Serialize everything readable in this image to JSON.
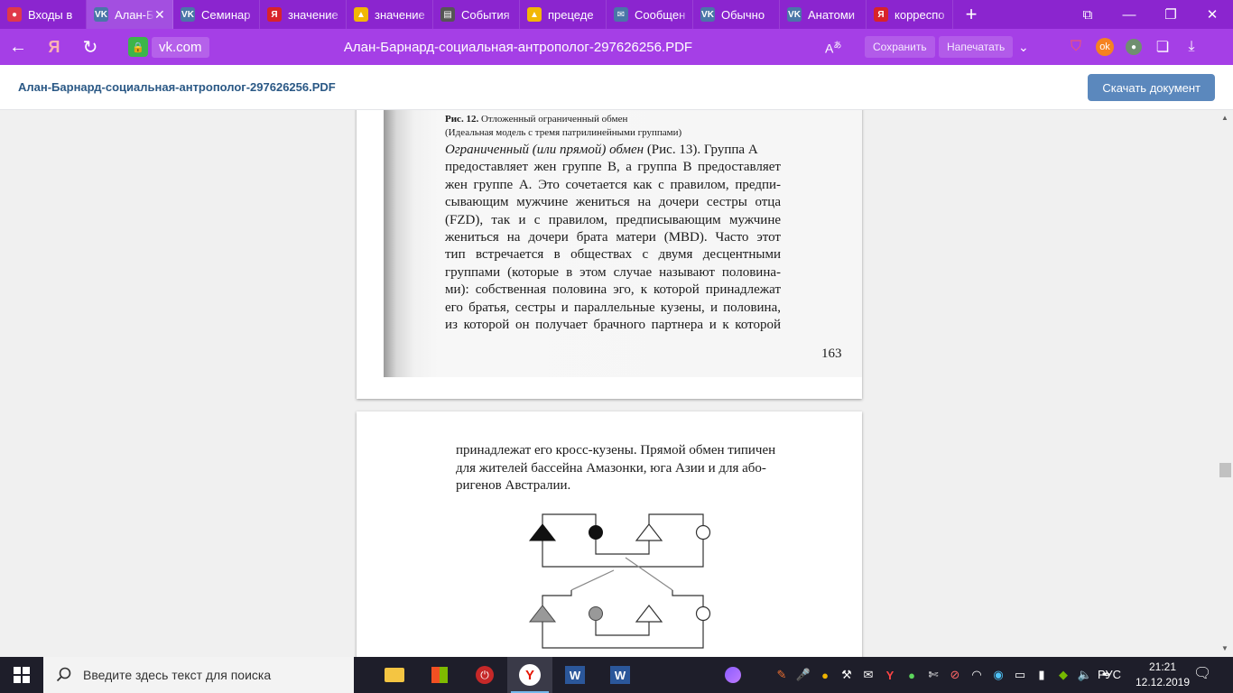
{
  "tabs": [
    {
      "title": "Входы в",
      "fav_color": "#e0394a",
      "fav_glyph": "●",
      "active": false
    },
    {
      "title": "Алан-Б",
      "fav_color": "#4a76a8",
      "fav_glyph": "VK",
      "active": true
    },
    {
      "title": "Семинар",
      "fav_color": "#4a76a8",
      "fav_glyph": "VK",
      "active": false
    },
    {
      "title": "значение",
      "fav_color": "#d8232a",
      "fav_glyph": "Я",
      "active": false
    },
    {
      "title": "значение",
      "fav_color": "#f2b705",
      "fav_glyph": "▲",
      "active": false
    },
    {
      "title": "События",
      "fav_color": "#555555",
      "fav_glyph": "▤",
      "active": false
    },
    {
      "title": "прецеде",
      "fav_color": "#f2b705",
      "fav_glyph": "▲",
      "active": false
    },
    {
      "title": "Сообщен",
      "fav_color": "#4a76a8",
      "fav_glyph": "✉",
      "active": false
    },
    {
      "title": "Обычно",
      "fav_color": "#4a76a8",
      "fav_glyph": "VK",
      "active": false
    },
    {
      "title": "Анатоми",
      "fav_color": "#4a76a8",
      "fav_glyph": "VK",
      "active": false
    },
    {
      "title": "корреспо",
      "fav_color": "#d8232a",
      "fav_glyph": "Я",
      "active": false
    }
  ],
  "address": {
    "domain": "vk.com",
    "page_title": "Алан-Барнард-социальная-антрополог-297626256.PDF",
    "save_label": "Сохранить",
    "print_label": "Напечатать"
  },
  "doc_header": {
    "filename": "Алан-Барнард-социальная-антрополог-297626256.PDF",
    "download_label": "Скачать документ"
  },
  "page1": {
    "caption_bold": "Рис. 12.",
    "caption_rest": " Отложенный ограниченный обмен",
    "caption_sub": "(Идеальная модель с тремя патрилинейными группами)",
    "term": "Ограниченный (или прямой) обмен",
    "lines": [
      " (Рис. 13). Группа А",
      "предоставляет жен группе В, а группа В предоставляет",
      "жен группе А. Это сочетается как с правилом, предпи-",
      "сывающим мужчине жениться на дочери сестры отца",
      "(FZD), так и с правилом, предписывающим мужчине",
      "жениться на дочери брата матери (MBD). Часто этот",
      "тип встречается в обществах с двумя десцентными",
      "группами (которые в этом случае называют половина-",
      "ми): собственная половина эго, к которой принадлежат",
      "его братья, сестры и параллельные кузены, и половина,",
      "из которой он получает брачного партнера и к которой"
    ],
    "page_number": "163"
  },
  "page2": {
    "lines": [
      "принадлежат его кросс-кузены. Прямой обмен типичен",
      "для жителей бассейна Амазонки, юга Азии и для або-",
      "ригенов Австралии."
    ]
  },
  "taskbar": {
    "search_placeholder": "Введите здесь текст для поиска",
    "lang": "РУС",
    "time": "21:21",
    "date": "12.12.2019"
  }
}
